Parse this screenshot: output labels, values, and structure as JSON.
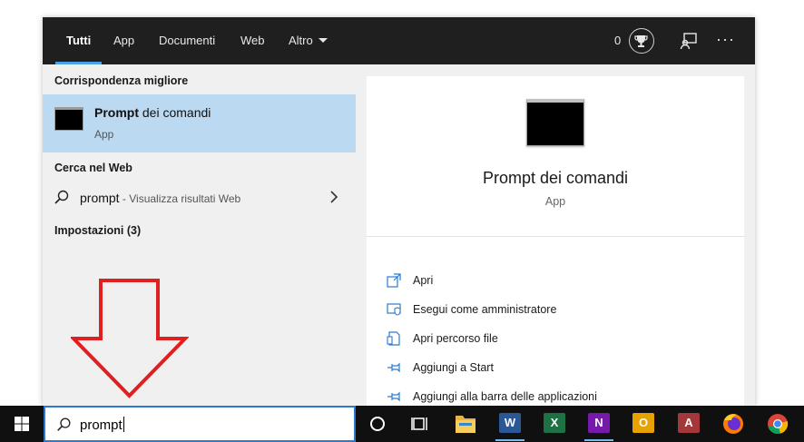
{
  "tabs": [
    {
      "label": "Tutti"
    },
    {
      "label": "App"
    },
    {
      "label": "Documenti"
    },
    {
      "label": "Web"
    },
    {
      "label": "Altro"
    }
  ],
  "header": {
    "points": "0"
  },
  "best_match": {
    "heading": "Corrispondenza migliore",
    "title_bold": "Prompt",
    "title_rest": " dei comandi",
    "subtitle": "App"
  },
  "web": {
    "heading": "Cerca nel Web",
    "query": "prompt",
    "desc": " - Visualizza risultati Web"
  },
  "settings": {
    "heading": "Impostazioni (3)"
  },
  "preview": {
    "title": "Prompt dei comandi",
    "subtitle": "App",
    "actions": [
      {
        "label": "Apri",
        "icon": "open-icon"
      },
      {
        "label": "Esegui come amministratore",
        "icon": "shield-icon"
      },
      {
        "label": "Apri percorso file",
        "icon": "file-location-icon"
      },
      {
        "label": "Aggiungi a Start",
        "icon": "pin-icon"
      },
      {
        "label": "Aggiungi alla barra delle applicazioni",
        "icon": "pin-icon"
      }
    ]
  },
  "taskbar": {
    "search_text": "prompt",
    "apps": [
      {
        "name": "cortana",
        "letter": ""
      },
      {
        "name": "task-view",
        "letter": ""
      },
      {
        "name": "file-explorer",
        "letter": ""
      },
      {
        "name": "word",
        "letter": "W"
      },
      {
        "name": "excel",
        "letter": "X"
      },
      {
        "name": "onenote",
        "letter": "N"
      },
      {
        "name": "outlook",
        "letter": "O"
      },
      {
        "name": "access",
        "letter": "A"
      },
      {
        "name": "firefox",
        "letter": ""
      },
      {
        "name": "chrome",
        "letter": ""
      }
    ]
  },
  "colors": {
    "accent": "#4aa0e6",
    "selection": "#bcd9f2",
    "annotation_arrow": "#e02020"
  }
}
